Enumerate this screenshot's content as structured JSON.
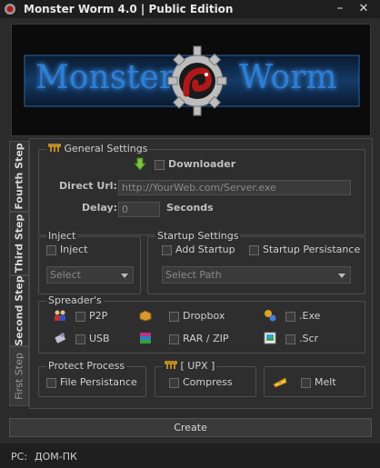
{
  "window": {
    "title": "Monster Worm 4.0  |  Public Edition",
    "minimize_glyph": "–",
    "close_glyph": "✕",
    "app_icon": "worm-app-icon"
  },
  "banner": {
    "word_left": "Monster",
    "word_right": "Worm",
    "emblem": "gear-worm-emblem",
    "colors": {
      "text": "#2d7fd6",
      "emblem": "#c8c8c8",
      "worm": "#b01818"
    }
  },
  "side_tabs": [
    "Fourth Step",
    "Third Step",
    "Second Step",
    "First Step"
  ],
  "general_settings": {
    "title": "General Settings",
    "downloader_label": "Downloader",
    "direct_url_label": "Direct Url:",
    "direct_url_value": "http://YourWeb.com/Server.exe",
    "delay_label": "Delay:",
    "delay_value": "0",
    "seconds_label": "Seconds"
  },
  "inject": {
    "title": "Inject",
    "checkbox_label": "Inject",
    "select_value": "Select"
  },
  "startup": {
    "title": "Startup Settings",
    "add_startup_label": "Add Startup",
    "persistance_label": "Startup Persistance",
    "select_value": "Select Path"
  },
  "spreaders": {
    "title": "Spreader's",
    "items": [
      "P2P",
      "Dropbox",
      ".Exe",
      "USB",
      "RAR / ZIP",
      ".Scr"
    ]
  },
  "protect": {
    "title": "Protect Process",
    "checkbox_label": "File Persistance"
  },
  "upx": {
    "title": "[ UPX ]",
    "checkbox_label": "Compress"
  },
  "melt": {
    "checkbox_label": "Melt"
  },
  "create_button": "Create",
  "status": {
    "label": "PC:",
    "value": "ДОМ-ПК"
  }
}
